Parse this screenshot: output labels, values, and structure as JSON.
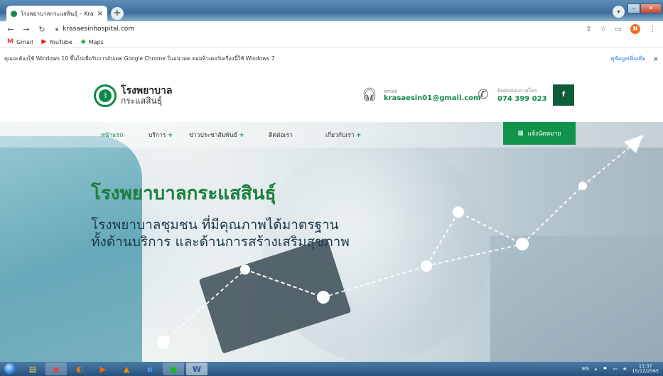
{
  "browser": {
    "tab_title": "โรงพยาบาลกระแสสินธุ์ – Krasaesi",
    "tab_close": "×",
    "new_tab": "+",
    "url": "krasaesinhospital.com",
    "bookmarks": [
      {
        "label": "Gmail",
        "icon": "gmail-icon",
        "color": "#d44638",
        "glyph": "M"
      },
      {
        "label": "YouTube",
        "icon": "youtube-icon",
        "color": "#ff0000",
        "glyph": "▶"
      },
      {
        "label": "Maps",
        "icon": "maps-icon",
        "color": "#34a853",
        "glyph": "◆"
      }
    ],
    "profile_initial": "N",
    "infobar_text": "คุณจะต้องใช้ Windows 10 ขึ้นไปเพื่อรับการอัปเดต Google Chrome ในอนาคต คอมพิวเตอร์เครื่องนี้ใช้ Windows 7",
    "infobar_link": "ดูข้อมูลเพิ่มเติม",
    "infobar_close": "×"
  },
  "site": {
    "logo_line1": "โรงพยาบาล",
    "logo_line2": "กระแสสินธุ์",
    "email_label": "email",
    "email_value": "krasaesin01@gmail.com",
    "phone_label": "ติดต่อสอบถามโทร",
    "phone_value": "074 399 023",
    "facebook_glyph": "f",
    "nav": [
      {
        "label": "หน้าแรก",
        "plus": "",
        "active": true
      },
      {
        "label": "บริการ",
        "plus": "+",
        "active": false
      },
      {
        "label": "ข่าวประชาสัมพันธ์",
        "plus": "+",
        "active": false
      },
      {
        "label": "ติดต่อเรา",
        "plus": "",
        "active": false
      },
      {
        "label": "เกี่ยวกับเรา",
        "plus": "+",
        "active": false
      }
    ],
    "appointment_label": "แจ้งนัดหมาย",
    "hero_title": "โรงพยาบาลกระแสสินธุ์",
    "hero_sub1": "โรงพยาบาลชุมชน ที่มีคุณภาพได้มาตรฐาน",
    "hero_sub2": "ทั้งด้านบริการ และด้านการสร้างเสริมสุขภาพ",
    "accent_color": "#12934c"
  },
  "taskbar": {
    "apps": [
      {
        "name": "explorer",
        "glyph": "▤",
        "color": "#f2c94c"
      },
      {
        "name": "chrome",
        "glyph": "◉",
        "color": "#e94235"
      },
      {
        "name": "firefox",
        "glyph": "◐",
        "color": "#ff7b00"
      },
      {
        "name": "media",
        "glyph": "▶",
        "color": "#ff6a00"
      },
      {
        "name": "vlc",
        "glyph": "▲",
        "color": "#ff8800"
      },
      {
        "name": "ie",
        "glyph": "e",
        "color": "#4da6ff"
      },
      {
        "name": "line",
        "glyph": "▣",
        "color": "#00c300"
      },
      {
        "name": "word",
        "glyph": "W",
        "color": "#2b579a"
      }
    ],
    "lang": "EN",
    "time": "11:37",
    "date": "15/12/2565"
  }
}
